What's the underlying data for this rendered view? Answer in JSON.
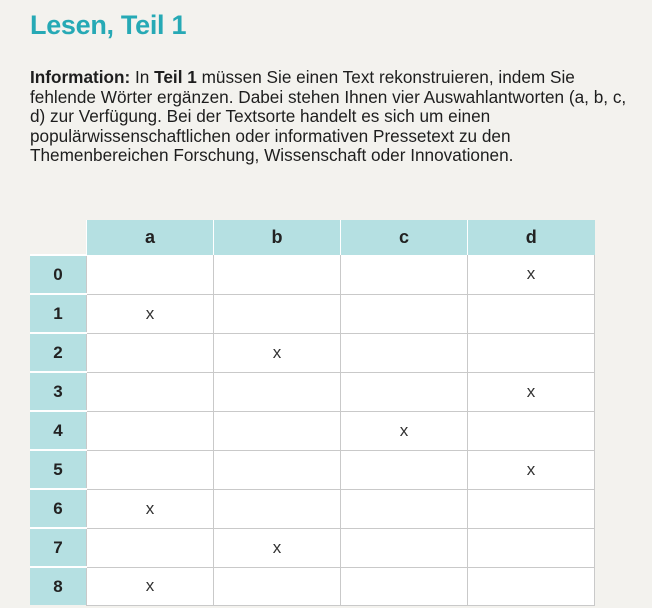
{
  "heading": "Lesen, Teil 1",
  "info": {
    "label": "Information:",
    "text_1": " In ",
    "bold_1": "Teil 1",
    "text_2": " müssen Sie einen Text rekonstruieren, indem Sie fehlende Wörter ergänzen. Dabei stehen Ihnen vier Auswahlantworten (a, b, c, d) zur Verfügung. Bei der Textsorte handelt es sich um einen populärwissenschaftlichen oder informativen Pressetext zu den Themenbereichen Forschung, Wissenschaft oder Innovationen."
  },
  "table": {
    "columns": [
      "a",
      "b",
      "c",
      "d"
    ],
    "rows": [
      {
        "label": "0",
        "cells": [
          "",
          "",
          "",
          "x"
        ]
      },
      {
        "label": "1",
        "cells": [
          "x",
          "",
          "",
          ""
        ]
      },
      {
        "label": "2",
        "cells": [
          "",
          "x",
          "",
          ""
        ]
      },
      {
        "label": "3",
        "cells": [
          "",
          "",
          "",
          "x"
        ]
      },
      {
        "label": "4",
        "cells": [
          "",
          "",
          "x",
          ""
        ]
      },
      {
        "label": "5",
        "cells": [
          "",
          "",
          "",
          "x"
        ]
      },
      {
        "label": "6",
        "cells": [
          "x",
          "",
          "",
          ""
        ]
      },
      {
        "label": "7",
        "cells": [
          "",
          "x",
          "",
          ""
        ]
      },
      {
        "label": "8",
        "cells": [
          "x",
          "",
          "",
          ""
        ]
      }
    ]
  }
}
